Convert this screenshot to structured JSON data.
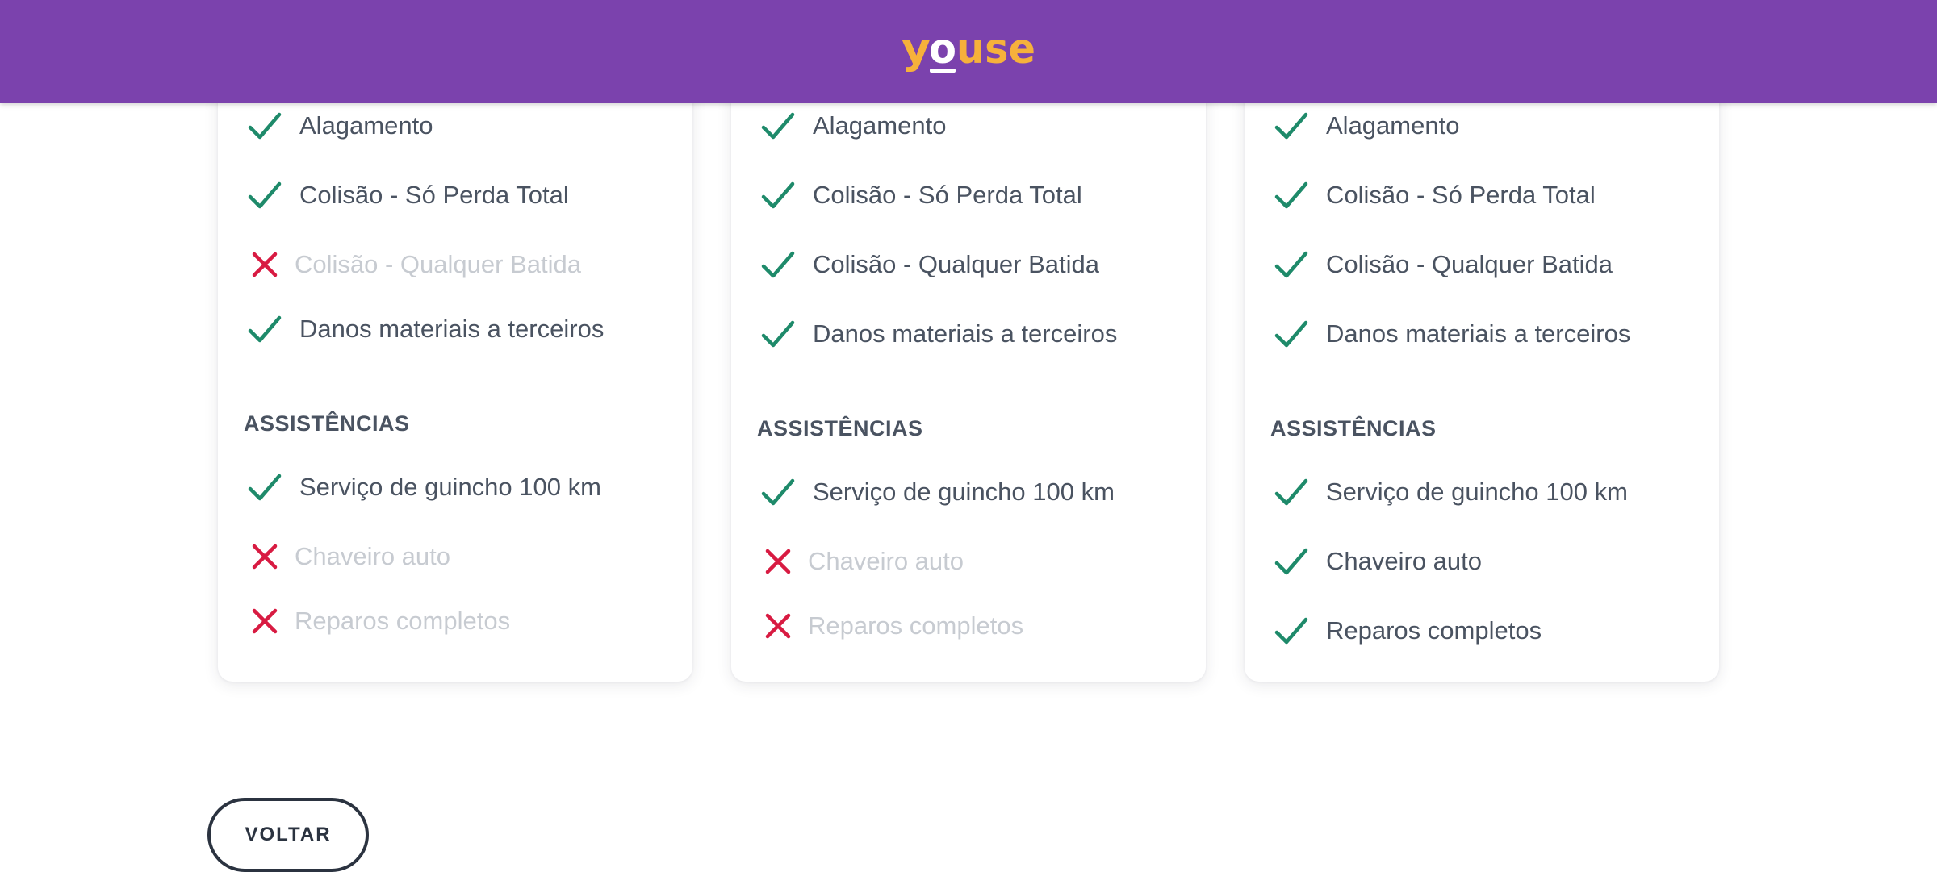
{
  "brand": {
    "logo_text": "youse",
    "header_color": "#7b42ad",
    "logo_color": "#f6b13b"
  },
  "colors": {
    "check": "#1e8a6a",
    "cross": "#d81b42",
    "disabled_text": "#c7cbd1"
  },
  "plans": [
    {
      "coverages": [
        {
          "label": "Alagamento",
          "included": true
        },
        {
          "label": "Colisão - Só Perda Total",
          "included": true
        },
        {
          "label": "Colisão - Qualquer Batida",
          "included": false
        },
        {
          "label": "Danos materiais a terceiros",
          "included": true
        }
      ],
      "assist_title": "ASSISTÊNCIAS",
      "assistances": [
        {
          "label": "Serviço de guincho 100 km",
          "included": true
        },
        {
          "label": "Chaveiro auto",
          "included": false
        },
        {
          "label": "Reparos completos",
          "included": false
        }
      ]
    },
    {
      "coverages": [
        {
          "label": "Alagamento",
          "included": true
        },
        {
          "label": "Colisão - Só Perda Total",
          "included": true
        },
        {
          "label": "Colisão - Qualquer Batida",
          "included": true
        },
        {
          "label": "Danos materiais a terceiros",
          "included": true
        }
      ],
      "assist_title": "ASSISTÊNCIAS",
      "assistances": [
        {
          "label": "Serviço de guincho 100 km",
          "included": true
        },
        {
          "label": "Chaveiro auto",
          "included": false
        },
        {
          "label": "Reparos completos",
          "included": false
        }
      ]
    },
    {
      "coverages": [
        {
          "label": "Alagamento",
          "included": true
        },
        {
          "label": "Colisão - Só Perda Total",
          "included": true
        },
        {
          "label": "Colisão - Qualquer Batida",
          "included": true
        },
        {
          "label": "Danos materiais a terceiros",
          "included": true
        }
      ],
      "assist_title": "ASSISTÊNCIAS",
      "assistances": [
        {
          "label": "Serviço de guincho 100 km",
          "included": true
        },
        {
          "label": "Chaveiro auto",
          "included": true
        },
        {
          "label": "Reparos completos",
          "included": true
        }
      ]
    }
  ],
  "back_button": {
    "label": "VOLTAR"
  }
}
